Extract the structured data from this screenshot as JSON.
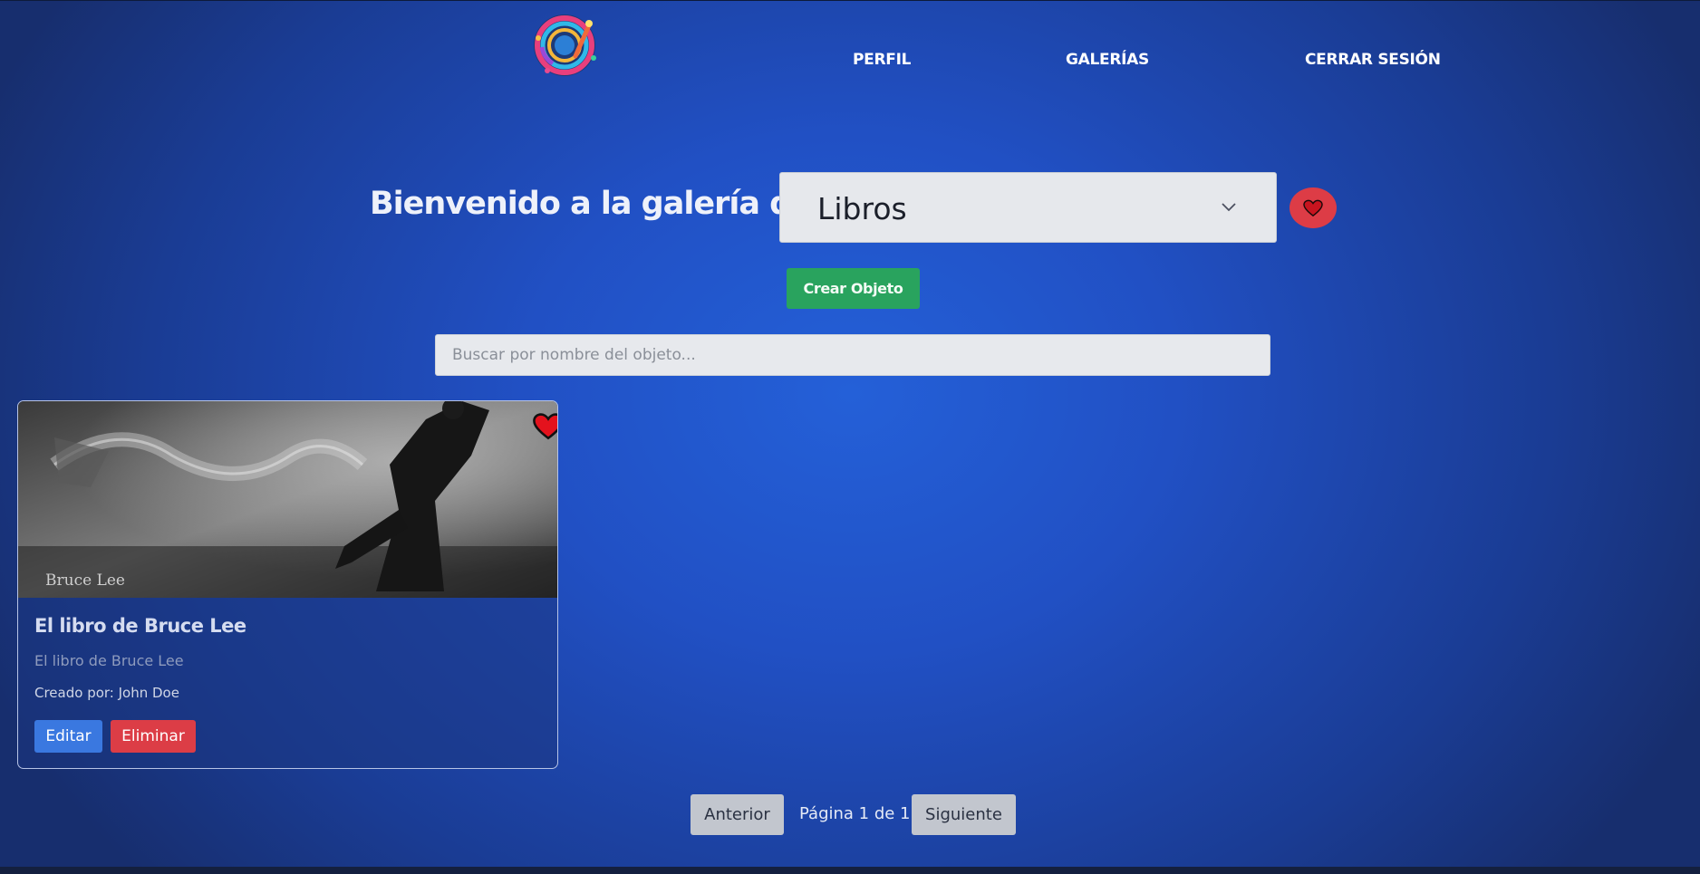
{
  "nav": {
    "logo_icon": "palette-brush-logo-icon",
    "links": [
      "PERFIL",
      "GALERÍAS",
      "CERRAR SESIÓN"
    ]
  },
  "header": {
    "welcome": "Bienvenido a la galería de",
    "gallery_select": {
      "selected": "Libros",
      "icon": "chevron-down-icon"
    },
    "favorite_icon": "heart-icon"
  },
  "actions": {
    "create_label": "Crear Objeto"
  },
  "search": {
    "placeholder": "Buscar por nombre del objeto...",
    "value": ""
  },
  "items": [
    {
      "title": "El libro de Bruce Lee",
      "description": "El libro de Bruce Lee",
      "author": "Creado por: John Doe",
      "image_caption": "Bruce Lee",
      "favorite": true,
      "edit_label": "Editar",
      "delete_label": "Eliminar"
    }
  ],
  "pagination": {
    "prev_label": "Anterior",
    "info": "Página 1 de 1",
    "next_label": "Siguiente"
  },
  "colors": {
    "background": "#2150c4",
    "accent_red": "#dd3c46",
    "accent_green": "#29a35e",
    "accent_blue": "#3a78e0"
  }
}
